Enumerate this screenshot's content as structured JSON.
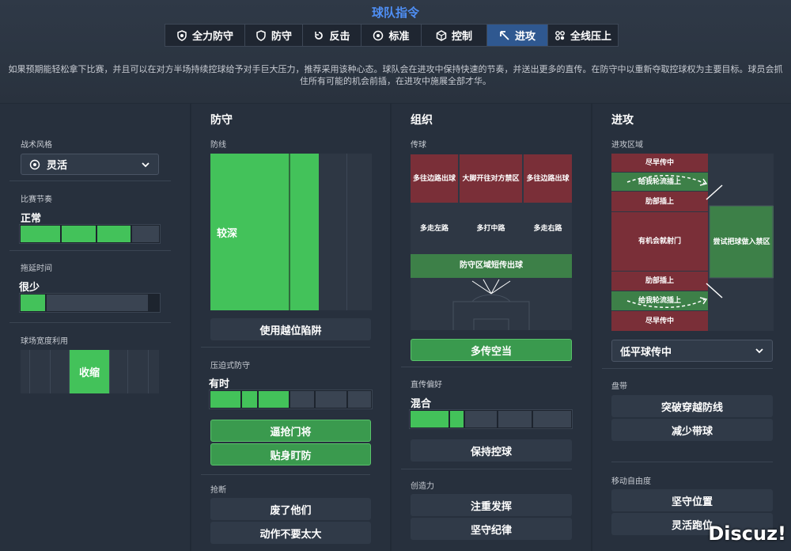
{
  "header": {
    "title": "球队指令",
    "description": "如果预期能轻松拿下比赛，并且可以在对方半场持续控球给予对手巨大压力，推荐采用该种心态。球队会在进攻中保持快速的节奏，并送出更多的直传。在防守中以重新夺取控球权为主要目标。球员会抓住所有可能的机会前插，在进攻中施展全部才华。",
    "tabs": [
      {
        "label": "全力防守",
        "icon": "shield-star-icon"
      },
      {
        "label": "防守",
        "icon": "shield-icon"
      },
      {
        "label": "反击",
        "icon": "counter-icon"
      },
      {
        "label": "标准",
        "icon": "ball-icon"
      },
      {
        "label": "控制",
        "icon": "cube-icon"
      },
      {
        "label": "进攻",
        "icon": "arrow-icon",
        "active": true
      },
      {
        "label": "全线压上",
        "icon": "rocket-icon"
      }
    ]
  },
  "left": {
    "style_label": "战术风格",
    "style_value": "灵活",
    "tempo_label": "比赛节奏",
    "tempo_value": "正常",
    "tempo_level": 0.75,
    "time_label": "拖延时间",
    "time_value": "很少",
    "time_level": 0.2,
    "width_label": "球场宽度利用",
    "width_value": "收缩"
  },
  "defense": {
    "title": "防守",
    "line_label": "防线",
    "line_value": "较深",
    "offside_btn": "使用越位陷阱",
    "press_label": "压迫式防守",
    "press_value": "有时",
    "press_level": 0.5,
    "press_btns": [
      "逼抢门将",
      "贴身盯防"
    ],
    "tackle_label": "抢断",
    "tackle_btns": [
      "废了他们",
      "动作不要太大"
    ]
  },
  "build": {
    "title": "组织",
    "pass_label": "传球",
    "grid": [
      "多往边路出球",
      "大脚开往对方禁区",
      "多往边路出球",
      "多走左路",
      "多打中路",
      "多走右路"
    ],
    "short_out": "防守区域短传出球",
    "options_btn": "多传空当",
    "direct_label": "直传偏好",
    "direct_value": "混合",
    "direct_level": 0.33,
    "keep_btn": "保持控球",
    "creative_label": "创造力",
    "creative_btns": [
      "注重发挥",
      "坚守纪律"
    ]
  },
  "attack": {
    "title": "进攻",
    "zone_label": "进攻区域",
    "zones": [
      "尽早传中",
      "给我轮流插上",
      "肋部插上",
      "有机会就射门",
      "肋部插上",
      "给我轮流插上",
      "尽早传中",
      "尝试把球做入禁区"
    ],
    "cross_select": "低平球传中",
    "dribble_label": "盘带",
    "dribble_btns": [
      "突破穿越防线",
      "减少带球"
    ],
    "freedom_label": "移动自由度",
    "freedom_btns": [
      "坚守位置",
      "灵活跑位"
    ]
  },
  "watermark": "Discuz!"
}
